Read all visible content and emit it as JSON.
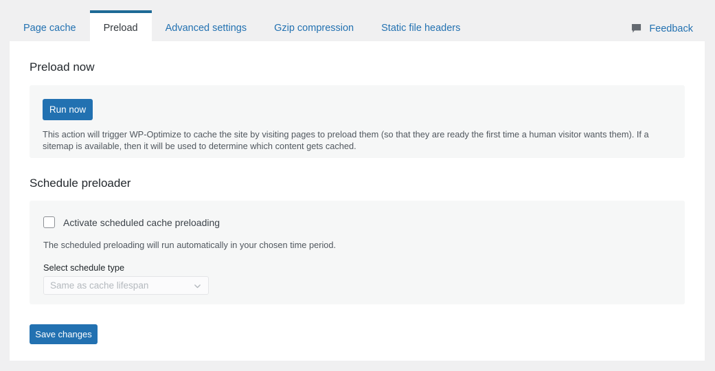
{
  "tabs": [
    {
      "label": "Page cache",
      "active": false,
      "name": "tab-page-cache"
    },
    {
      "label": "Preload",
      "active": true,
      "name": "tab-preload"
    },
    {
      "label": "Advanced settings",
      "active": false,
      "name": "tab-advanced-settings"
    },
    {
      "label": "Gzip compression",
      "active": false,
      "name": "tab-gzip-compression"
    },
    {
      "label": "Static file headers",
      "active": false,
      "name": "tab-static-file-headers"
    }
  ],
  "feedback": {
    "label": "Feedback",
    "icon": "speech-bubble-icon"
  },
  "preload_now": {
    "heading": "Preload now",
    "run_button": "Run now",
    "description": "This action will trigger WP-Optimize to cache the site by visiting pages to preload them (so that they are ready the first time a human visitor wants them). If a sitemap is available, then it will be used to determine which content gets cached."
  },
  "schedule_preloader": {
    "heading": "Schedule preloader",
    "activate_label": "Activate scheduled cache preloading",
    "activate_checked": false,
    "description": "The scheduled preloading will run automatically in your chosen time period.",
    "select_label": "Select schedule type",
    "select_value": "Same as cache lifespan",
    "select_disabled": true,
    "select_options": [
      "Same as cache lifespan"
    ],
    "chevron_icon": "chevron-down-icon"
  },
  "footer": {
    "save_label": "Save changes"
  },
  "colors": {
    "accent": "#2271b1",
    "active_tab_border": "#1d6a96",
    "page_background": "#f0f0f1",
    "panel_background": "#f6f7f7",
    "card_background": "#ffffff",
    "link": "#2271b1",
    "muted_text": "#50575e"
  }
}
